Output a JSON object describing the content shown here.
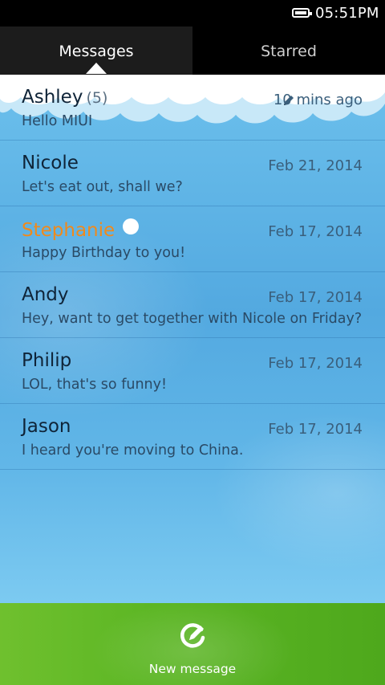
{
  "status_bar": {
    "time": "05:51PM",
    "icons": [
      "battery-icon"
    ]
  },
  "tabs": [
    {
      "label": "Messages",
      "active": true
    },
    {
      "label": "Starred",
      "active": false
    }
  ],
  "conversations": [
    {
      "name": "Ashley",
      "count": "(5)",
      "date": "10 mins ago",
      "preview": "Hello MIUI",
      "draft": true,
      "unread": false
    },
    {
      "name": "Nicole",
      "count": "",
      "date": "Feb 21, 2014",
      "preview": "Let's eat out, shall we?",
      "draft": false,
      "unread": false
    },
    {
      "name": "Stephanie",
      "count": "",
      "date": "Feb 17, 2014",
      "preview": "Happy Birthday to you!",
      "draft": false,
      "unread": true
    },
    {
      "name": "Andy",
      "count": "",
      "date": "Feb 17, 2014",
      "preview": "Hey, want to get together with Nicole on Friday?",
      "draft": false,
      "unread": false
    },
    {
      "name": "Philip",
      "count": "",
      "date": "Feb 17, 2014",
      "preview": "LOL, that's so funny!",
      "draft": false,
      "unread": false
    },
    {
      "name": "Jason",
      "count": "",
      "date": "Feb 17, 2014",
      "preview": "I heard you're moving to China.",
      "draft": false,
      "unread": false
    }
  ],
  "bottom_bar": {
    "label": "New message",
    "icon": "compose-icon"
  },
  "colors": {
    "accent_unread": "#f08a1c",
    "bottom_bar": "#5cb624",
    "list_background": "#5aaee2"
  }
}
